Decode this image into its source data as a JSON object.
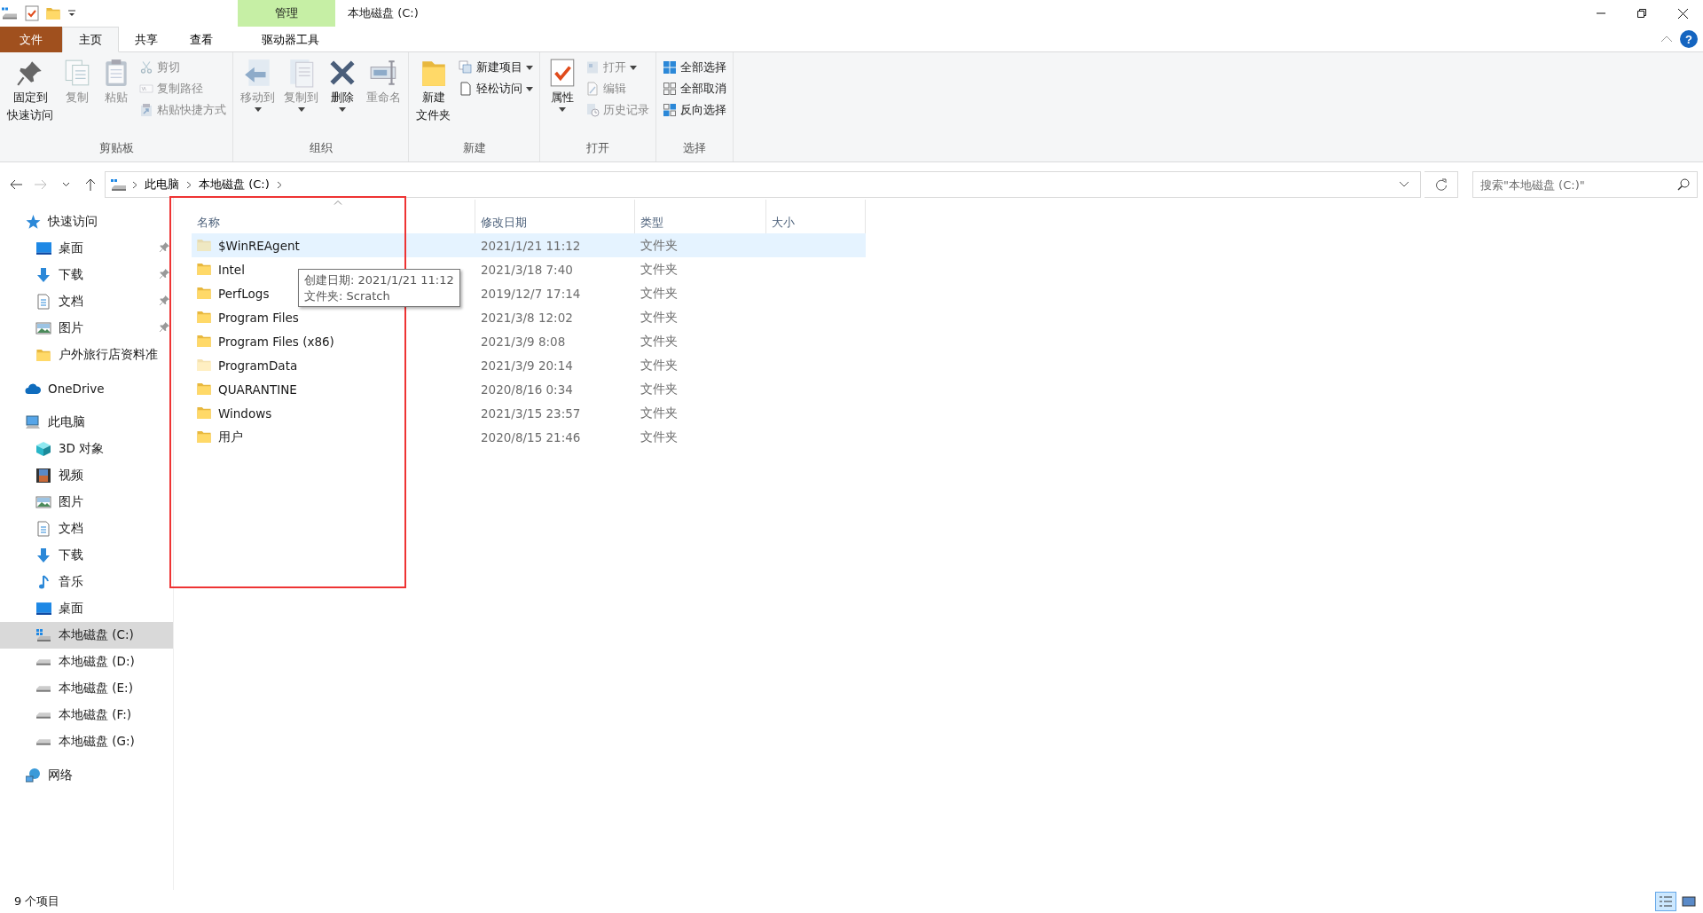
{
  "title_bar": {
    "context_tab": "管理",
    "title": "本地磁盘 (C:)"
  },
  "ribbon_tabs": [
    {
      "label": "文件",
      "kind": "file",
      "selected": false
    },
    {
      "label": "主页",
      "kind": "normal",
      "selected": true
    },
    {
      "label": "共享",
      "kind": "normal",
      "selected": false
    },
    {
      "label": "查看",
      "kind": "normal",
      "selected": false
    },
    {
      "label": "驱动器工具",
      "kind": "context",
      "selected": false
    }
  ],
  "help": "?",
  "ribbon_groups": [
    {
      "label": "剪贴板",
      "commands": [
        {
          "label": [
            "固定到",
            "快速访问"
          ],
          "kind": "large",
          "disabled": false,
          "has_menu": false
        },
        {
          "label": [
            "复制"
          ],
          "kind": "large",
          "disabled": true,
          "has_menu": false
        },
        {
          "label": [
            "粘贴"
          ],
          "kind": "large",
          "disabled": true,
          "has_menu": false
        },
        {
          "label": [
            "剪切"
          ],
          "kind": "small",
          "disabled": true,
          "has_menu": false
        },
        {
          "label": [
            "复制路径"
          ],
          "kind": "small",
          "disabled": true,
          "has_menu": false
        },
        {
          "label": [
            "粘贴快捷方式"
          ],
          "kind": "small",
          "disabled": true,
          "has_menu": false
        }
      ]
    },
    {
      "label": "组织",
      "commands": [
        {
          "label": [
            "移动到"
          ],
          "kind": "large",
          "disabled": true,
          "has_menu": true
        },
        {
          "label": [
            "复制到"
          ],
          "kind": "large",
          "disabled": true,
          "has_menu": true
        },
        {
          "label": [
            "删除"
          ],
          "kind": "large",
          "disabled": false,
          "has_menu": true
        },
        {
          "label": [
            "重命名"
          ],
          "kind": "large",
          "disabled": true,
          "has_menu": false
        }
      ]
    },
    {
      "label": "新建",
      "commands": [
        {
          "label": [
            "新建",
            "文件夹"
          ],
          "kind": "large",
          "disabled": false,
          "has_menu": false
        },
        {
          "label": [
            "新建项目"
          ],
          "kind": "small",
          "disabled": false,
          "has_menu": true
        },
        {
          "label": [
            "轻松访问"
          ],
          "kind": "small",
          "disabled": false,
          "has_menu": true
        }
      ]
    },
    {
      "label": "打开",
      "commands": [
        {
          "label": [
            "属性"
          ],
          "kind": "large",
          "disabled": false,
          "has_menu": true
        },
        {
          "label": [
            "打开"
          ],
          "kind": "small",
          "disabled": true,
          "has_menu": true
        },
        {
          "label": [
            "编辑"
          ],
          "kind": "small",
          "disabled": true,
          "has_menu": false
        },
        {
          "label": [
            "历史记录"
          ],
          "kind": "small",
          "disabled": true,
          "has_menu": false
        }
      ]
    },
    {
      "label": "选择",
      "commands": [
        {
          "label": [
            "全部选择"
          ],
          "kind": "small",
          "disabled": false,
          "has_menu": false
        },
        {
          "label": [
            "全部取消"
          ],
          "kind": "small",
          "disabled": false,
          "has_menu": false
        },
        {
          "label": [
            "反向选择"
          ],
          "kind": "small",
          "disabled": false,
          "has_menu": false
        }
      ]
    }
  ],
  "breadcrumb": [
    "此电脑",
    "本地磁盘 (C:)"
  ],
  "search": {
    "placeholder": "搜索\"本地磁盘 (C:)\""
  },
  "sidebar": [
    {
      "label": "快速访问",
      "kind": "star",
      "selected": false,
      "children": [
        {
          "label": "桌面",
          "kind": "desktop",
          "selected": false,
          "pinned": true
        },
        {
          "label": "下载",
          "kind": "download",
          "selected": false,
          "pinned": true
        },
        {
          "label": "文档",
          "kind": "document",
          "selected": false,
          "pinned": true
        },
        {
          "label": "图片",
          "kind": "picture",
          "selected": false,
          "pinned": true
        },
        {
          "label": "户外旅行店资料准",
          "kind": "folder",
          "selected": false,
          "pinned": false
        }
      ]
    },
    {
      "label": "OneDrive",
      "kind": "cloud",
      "selected": false
    },
    {
      "label": "此电脑",
      "kind": "computer",
      "selected": false,
      "children": [
        {
          "label": "3D 对象",
          "kind": "cube",
          "selected": false
        },
        {
          "label": "视频",
          "kind": "video",
          "selected": false
        },
        {
          "label": "图片",
          "kind": "picture",
          "selected": false
        },
        {
          "label": "文档",
          "kind": "document",
          "selected": false
        },
        {
          "label": "下载",
          "kind": "download",
          "selected": false
        },
        {
          "label": "音乐",
          "kind": "music",
          "selected": false
        },
        {
          "label": "桌面",
          "kind": "desktop",
          "selected": false
        },
        {
          "label": "本地磁盘 (C:)",
          "kind": "system_drive",
          "selected": true
        },
        {
          "label": "本地磁盘 (D:)",
          "kind": "drive",
          "selected": false
        },
        {
          "label": "本地磁盘 (E:)",
          "kind": "drive",
          "selected": false
        },
        {
          "label": "本地磁盘 (F:)",
          "kind": "drive",
          "selected": false
        },
        {
          "label": "本地磁盘 (G:)",
          "kind": "drive",
          "selected": false
        }
      ]
    },
    {
      "label": "网络",
      "kind": "network",
      "selected": false
    }
  ],
  "columns": [
    {
      "label": "名称",
      "sorted": true
    },
    {
      "label": "修改日期",
      "sorted": false
    },
    {
      "label": "类型",
      "sorted": false
    },
    {
      "label": "大小",
      "sorted": false
    }
  ],
  "rows": [
    {
      "name": "$WinREAgent",
      "modified": "2021/1/21 11:12",
      "type": "文件夹",
      "hidden": true,
      "selected": true
    },
    {
      "name": "Intel",
      "modified": "2021/3/18 7:40",
      "type": "文件夹",
      "hidden": false,
      "selected": false
    },
    {
      "name": "PerfLogs",
      "modified": "2019/12/7 17:14",
      "type": "文件夹",
      "hidden": false,
      "selected": false
    },
    {
      "name": "Program Files",
      "modified": "2021/3/8 12:02",
      "type": "文件夹",
      "hidden": false,
      "selected": false
    },
    {
      "name": "Program Files (x86)",
      "modified": "2021/3/9 8:08",
      "type": "文件夹",
      "hidden": false,
      "selected": false
    },
    {
      "name": "ProgramData",
      "modified": "2021/3/9 20:14",
      "type": "文件夹",
      "hidden": true,
      "selected": false
    },
    {
      "name": "QUARANTINE",
      "modified": "2020/8/16 0:34",
      "type": "文件夹",
      "hidden": false,
      "selected": false
    },
    {
      "name": "Windows",
      "modified": "2021/3/15 23:57",
      "type": "文件夹",
      "hidden": false,
      "selected": false
    },
    {
      "name": "用户",
      "modified": "2020/8/15 21:46",
      "type": "文件夹",
      "hidden": false,
      "selected": false
    }
  ],
  "tooltip": [
    "创建日期: 2021/1/21 11:12",
    "文件夹: Scratch"
  ],
  "annotation": {
    "kind": "rectangle"
  },
  "status_bar": {
    "count": "9 个项目"
  },
  "view_buttons": [
    {
      "kind": "details",
      "selected": true
    },
    {
      "kind": "large_icons",
      "selected": false
    }
  ]
}
